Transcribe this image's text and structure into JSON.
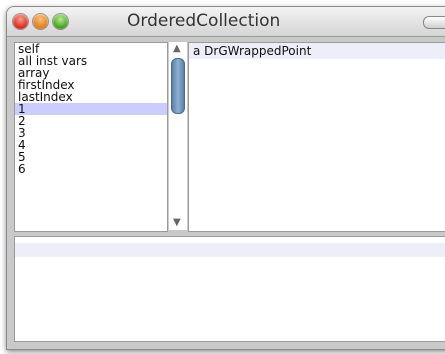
{
  "window": {
    "title": "OrderedCollection"
  },
  "inspector": {
    "fields": [
      "self",
      "all inst vars",
      "array",
      "firstIndex",
      "lastIndex",
      "1",
      "2",
      "3",
      "4",
      "5",
      "6"
    ],
    "selected_index": 5,
    "value_text": "a DrGWrappedPoint",
    "code_text": ""
  },
  "icons": {
    "close": "close-button-icon",
    "minimize": "minimize-button-icon",
    "zoom": "zoom-button-icon",
    "toolbar": "toolbar-toggle-icon",
    "scroll_up": "scroll-up-arrow-icon",
    "scroll_down": "scroll-down-arrow-icon"
  },
  "colors": {
    "selection": "#ccccff",
    "panel_background": "#c9c9c9"
  }
}
